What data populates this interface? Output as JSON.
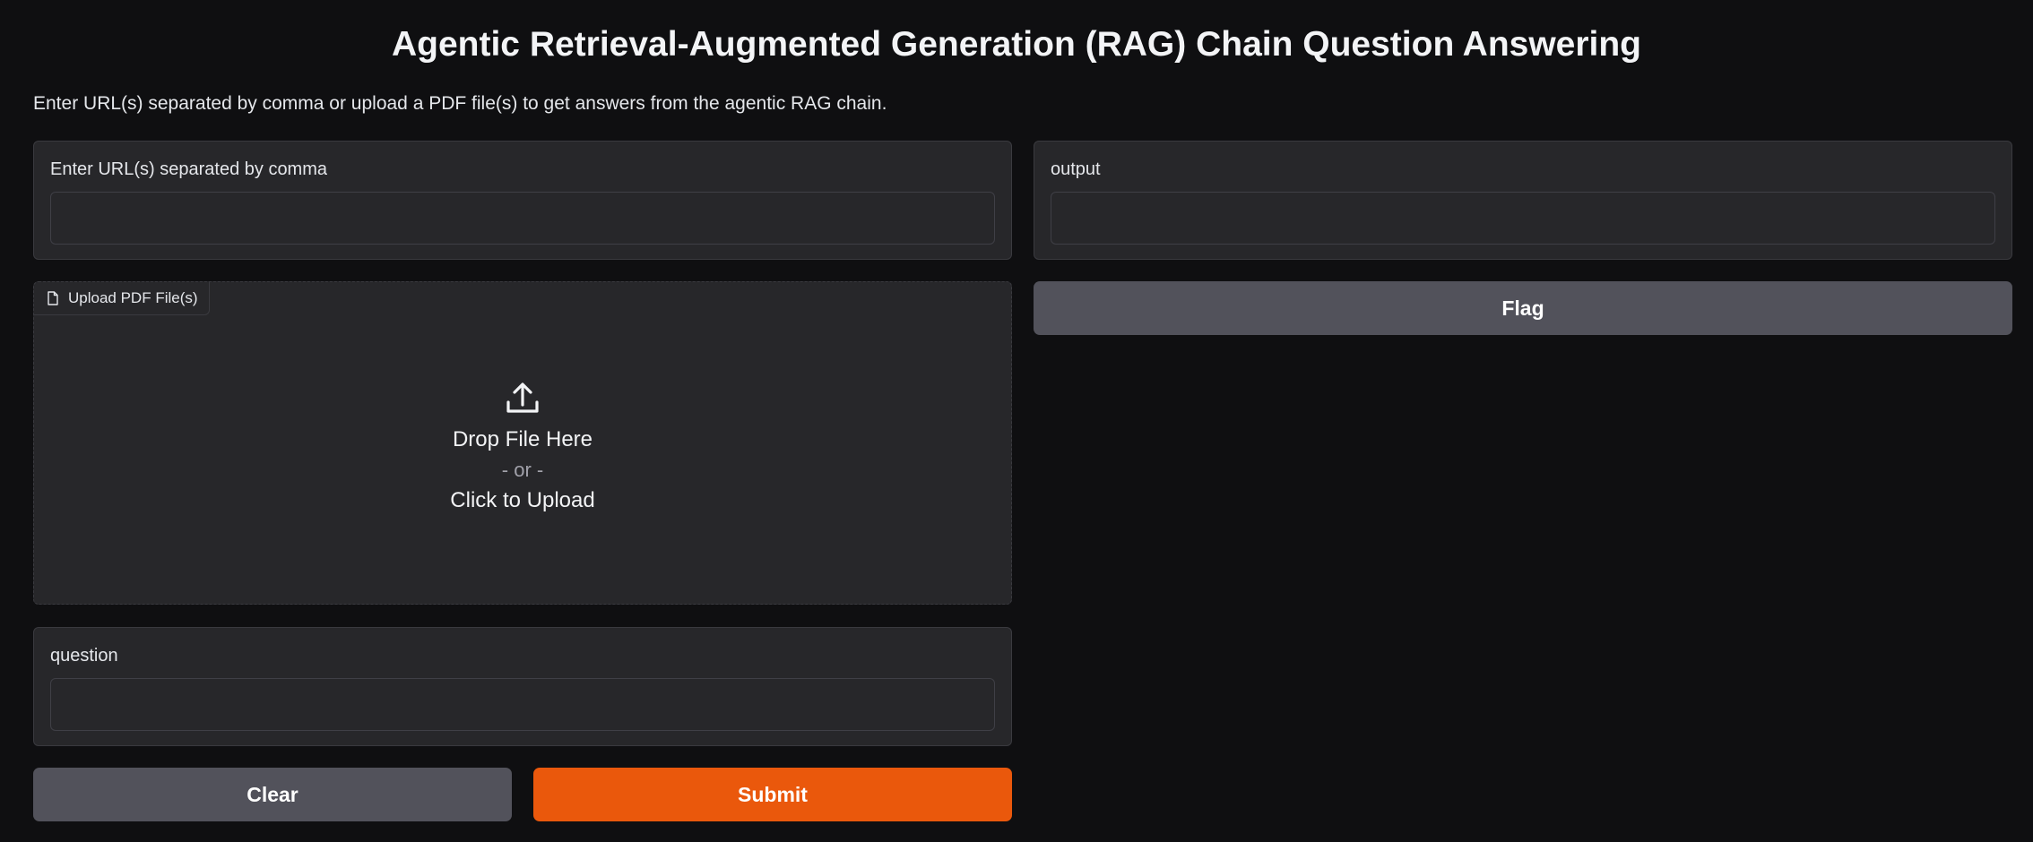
{
  "header": {
    "title": "Agentic Retrieval-Augmented Generation (RAG) Chain Question Answering",
    "description": "Enter URL(s) separated by comma or upload a PDF file(s) to get answers from the agentic RAG chain."
  },
  "inputs": {
    "urls": {
      "label": "Enter URL(s) separated by comma",
      "value": ""
    },
    "upload": {
      "label": "Upload PDF File(s)",
      "drop_text": "Drop File Here",
      "or_text": "- or -",
      "click_text": "Click to Upload"
    },
    "question": {
      "label": "question",
      "value": ""
    }
  },
  "outputs": {
    "output": {
      "label": "output",
      "value": ""
    }
  },
  "buttons": {
    "clear": "Clear",
    "submit": "Submit",
    "flag": "Flag"
  },
  "colors": {
    "background": "#0f0f11",
    "panel": "#27272a",
    "primary": "#ea580c",
    "secondary": "#52525b"
  },
  "icons": {
    "upload_tag": "file-icon",
    "upload_center": "upload-icon"
  }
}
